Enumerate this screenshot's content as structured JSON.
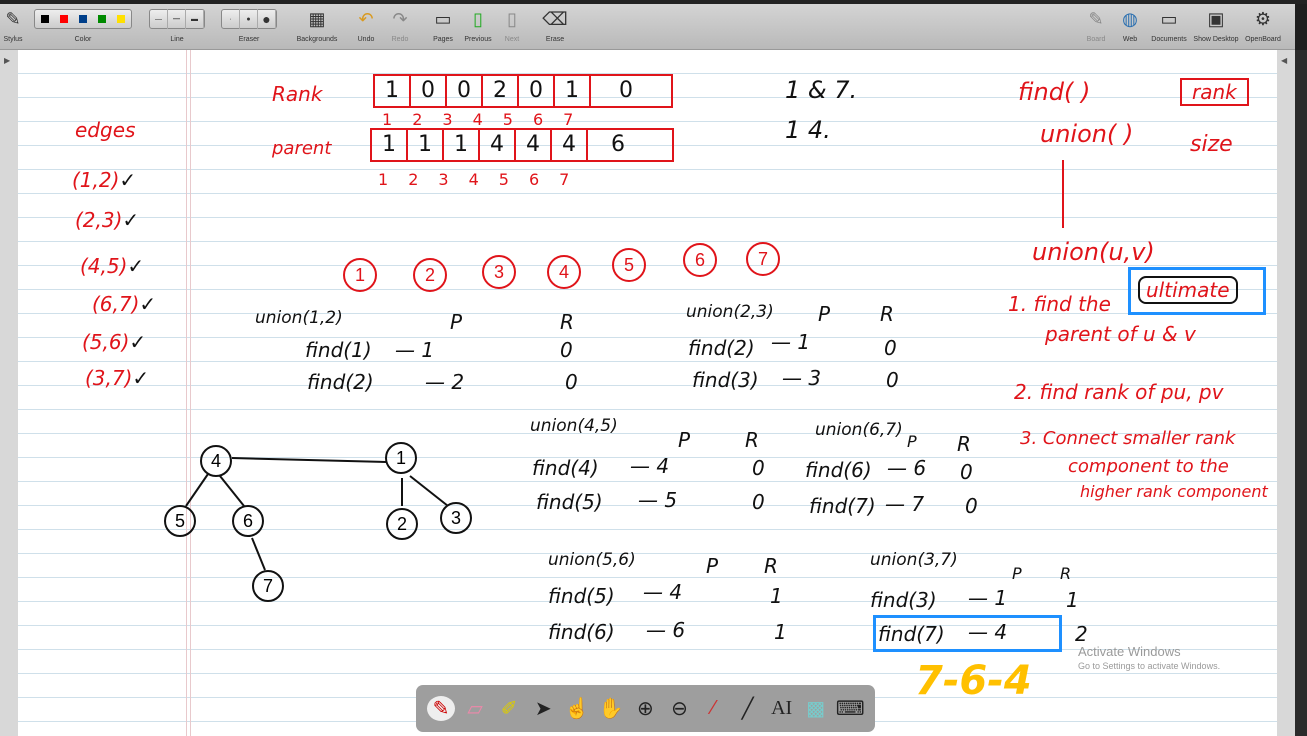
{
  "toolbar": {
    "left": [
      "Stylus",
      "Color",
      "Line",
      "Eraser",
      "Backgrounds",
      "Undo",
      "Redo",
      "Pages",
      "Previous",
      "Next",
      "Erase"
    ],
    "right": [
      "Board",
      "Web",
      "Documents",
      "Show Desktop",
      "OpenBoard"
    ],
    "colors": [
      "#000000",
      "#ff0000",
      "#003f8a",
      "#008a00",
      "#ffe000"
    ]
  },
  "board": {
    "rank_label": "Rank",
    "rank": [
      "1",
      "0",
      "0",
      "2",
      "0",
      "1",
      "0"
    ],
    "parent_label": "parent",
    "parent": [
      "1",
      "1",
      "1",
      "4",
      "4",
      "4",
      "6"
    ],
    "indices": [
      "1",
      "2",
      "3",
      "4",
      "5",
      "6",
      "7"
    ],
    "note1": "1 & 7.",
    "note2": "1   4.",
    "edges_title": "edges",
    "edges": [
      "(1,2)",
      "(2,3)",
      "(4,5)",
      "(6,7)",
      "(5,6)",
      "(3,7)"
    ],
    "check": "✓",
    "nodes": [
      "1",
      "2",
      "3",
      "4",
      "5",
      "6",
      "7"
    ],
    "unions": [
      {
        "title": "union(1,2)",
        "rows": [
          [
            "find(1)",
            "— 1",
            "0"
          ],
          [
            "find(2)",
            "— 2",
            "0"
          ]
        ]
      },
      {
        "title": "union(2,3)",
        "rows": [
          [
            "find(2)",
            "— 1",
            "0"
          ],
          [
            "find(3)",
            "— 3",
            "0"
          ]
        ]
      },
      {
        "title": "union(4,5)",
        "rows": [
          [
            "find(4)",
            "— 4",
            "0"
          ],
          [
            "find(5)",
            "— 5",
            "0"
          ]
        ]
      },
      {
        "title": "union(6,7)",
        "rows": [
          [
            "find(6)",
            "— 6",
            "0"
          ],
          [
            "find(7)",
            "— 7",
            "0"
          ]
        ]
      },
      {
        "title": "union(5,6)",
        "rows": [
          [
            "find(5)",
            "— 4",
            "1"
          ],
          [
            "find(6)",
            "— 6",
            "1"
          ]
        ]
      },
      {
        "title": "union(3,7)",
        "rows": [
          [
            "find(3)",
            "— 1",
            "1"
          ],
          [
            "find(7)",
            "— 4",
            "2"
          ]
        ]
      }
    ],
    "P": "P",
    "R": "R",
    "path": "7-6-4",
    "right": {
      "find": "find( )",
      "union": "union( )",
      "rank": "rank",
      "size": "size",
      "unionuv": "union(u,v)",
      "step1a": "1. find the",
      "ultimate": "ultimate",
      "step1b": "parent of  u & v",
      "step2": "2. find rank of  pu, pv",
      "step3a": "3. Connect smaller rank",
      "step3b": "component to the",
      "step3c": "higher rank component"
    }
  },
  "watermark": {
    "title": "Activate Windows",
    "sub": "Go to Settings to activate Windows."
  }
}
